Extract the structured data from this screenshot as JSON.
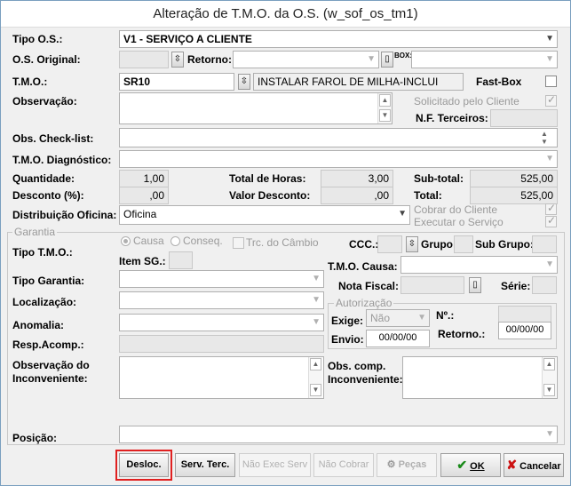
{
  "window": {
    "title": "Alteração de T.M.O. da O.S. (w_sof_os_tm1)"
  },
  "labels": {
    "tipo_os": "Tipo O.S.:",
    "os_original": "O.S. Original:",
    "retorno": "Retorno:",
    "box": "BOX:",
    "tmo": "T.M.O.:",
    "fast_box": "Fast-Box",
    "observacao": "Observação:",
    "solicitado_cliente": "Solicitado pelo Cliente",
    "nf_terceiros": "N.F. Terceiros:",
    "obs_checklist": "Obs. Check-list:",
    "tmo_diagnostico": "T.M.O. Diagnóstico:",
    "quantidade": "Quantidade:",
    "total_horas": "Total de Horas:",
    "sub_total": "Sub-total:",
    "desconto": "Desconto (%):",
    "valor_desconto": "Valor Desconto:",
    "total": "Total:",
    "distribuicao_oficina": "Distribuição Oficina:",
    "cobrar_cliente": "Cobrar do Cliente",
    "executar_servico": "Executar o Serviço"
  },
  "values": {
    "tipo_os": "V1 - SERVIÇO A CLIENTE",
    "os_original": "",
    "retorno": "",
    "box": "",
    "tmo_code": "SR10",
    "tmo_desc": "INSTALAR FAROL DE MILHA-INCLUI",
    "observacao": "",
    "nf_terceiros": "",
    "obs_checklist": "",
    "tmo_diagnostico": "",
    "quantidade": "1,00",
    "total_horas": "3,00",
    "sub_total": "525,00",
    "desconto": ",00",
    "valor_desconto": ",00",
    "total": "525,00",
    "distribuicao_oficina": "Oficina"
  },
  "garantia": {
    "title": "Garantia",
    "tipo_tmo": "Tipo T.M.O.:",
    "causa": "Causa",
    "conseq": "Conseq.",
    "trc_cambio": "Trc. do Câmbio",
    "ccc": "CCC.:",
    "grupo": "Grupo:",
    "sub_grupo": "Sub Grupo:",
    "item_sg": "Item SG.:",
    "tmo_causa": "T.M.O. Causa:",
    "tipo_garantia": "Tipo Garantia:",
    "nota_fiscal": "Nota Fiscal:",
    "serie": "Série:",
    "localizacao": "Localização:",
    "anomalia": "Anomalia:",
    "resp_acomp": "Resp.Acomp.:",
    "obs_inconveniente_1": "Observação do",
    "obs_inconveniente_2": "Inconveniente:",
    "obs_comp_1": "Obs. comp.",
    "obs_comp_2": "Inconveniente:"
  },
  "autorizacao": {
    "title": "Autorização",
    "exige": "Exige:",
    "exige_value": "Não",
    "no": "Nº.:",
    "envio": "Envio:",
    "envio_value": "00/00/00",
    "retorno": "Retorno.:",
    "retorno_value": "00/00/00"
  },
  "posicao": {
    "label": "Posição:",
    "value": ""
  },
  "buttons": {
    "desloc": "Desloc.",
    "serv_terc": "Serv. Terc.",
    "nao_exec_serv": "Não Exec Serv",
    "nao_cobrar": "Não Cobrar",
    "pecas": "Peças",
    "ok": "OK",
    "cancelar": "Cancelar"
  },
  "colors": {
    "highlight": "#e02020",
    "ok_green": "#1a8a1a",
    "cancel_red": "#cc1111"
  }
}
